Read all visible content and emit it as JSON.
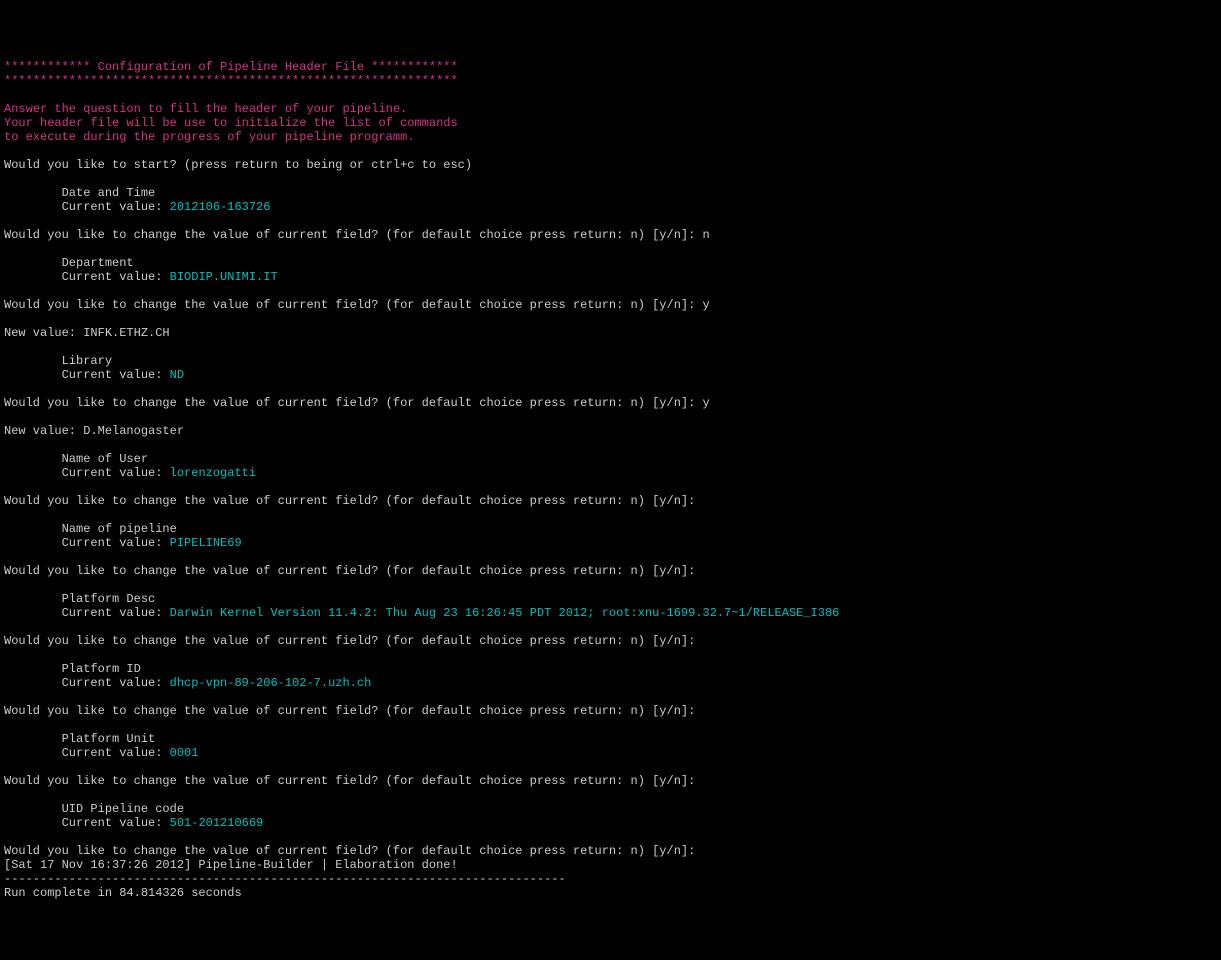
{
  "header": {
    "line1": "************ Configuration of Pipeline Header File ************",
    "line2": "***************************************************************",
    "blurb1": "Answer the question to fill the header of your pipeline.",
    "blurb2": "Your header file will be use to initialize the list of commands",
    "blurb3": "to execute during the progress of your pipeline programm."
  },
  "start_prompt": "Would you like to start? (press return to being or ctrl+c to esc)",
  "change_prompt": "Would you like to change the value of current field? (for default choice press return: n) [y/n]:",
  "cv_label": "Current value: ",
  "nv_label": "New value: ",
  "indent": "        ",
  "fields": {
    "datetime": {
      "label": "Date and Time",
      "value": "2012106-163726",
      "answer": " n"
    },
    "dept": {
      "label": "Department",
      "value": "BIODIP.UNIMI.IT",
      "answer": " y",
      "newval": "INFK.ETHZ.CH"
    },
    "library": {
      "label": "Library",
      "value": "ND",
      "answer": " y",
      "newval": "D.Melanogaster"
    },
    "user": {
      "label": "Name of User",
      "value": "lorenzogatti",
      "answer": ""
    },
    "pipeline": {
      "label": "Name of pipeline",
      "value": "PIPELINE69",
      "answer": ""
    },
    "pdesc": {
      "label": "Platform Desc",
      "value": "Darwin Kernel Version 11.4.2: Thu Aug 23 16:26:45 PDT 2012; root:xnu-1699.32.7~1/RELEASE_I386",
      "answer": ""
    },
    "pid": {
      "label": "Platform ID",
      "value": "dhcp-vpn-89-206-102-7.uzh.ch",
      "answer": ""
    },
    "punit": {
      "label": "Platform Unit",
      "value": "0001",
      "answer": ""
    },
    "uid": {
      "label": "UID Pipeline code",
      "value": "501-201210669",
      "answer": ""
    }
  },
  "footer": {
    "done": "[Sat 17 Nov 16:37:26 2012] Pipeline-Builder | Elaboration done!",
    "hr": "------------------------------------------------------------------------------",
    "run": "Run complete in 84.814326 seconds"
  }
}
